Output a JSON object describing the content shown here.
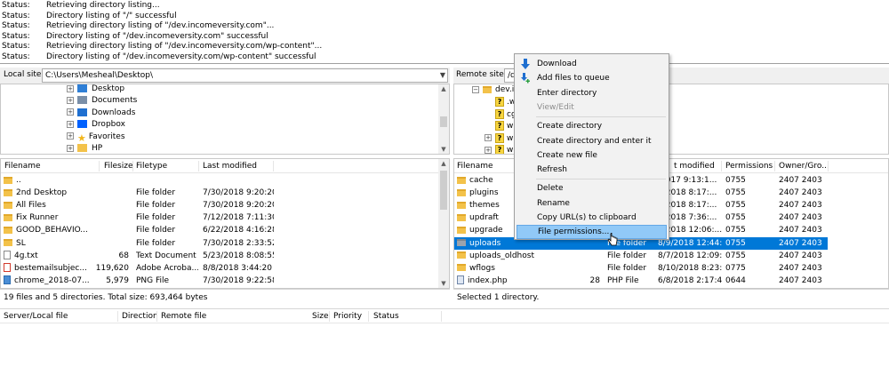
{
  "log": [
    {
      "label": "Status:",
      "text": "Retrieving directory listing..."
    },
    {
      "label": "Status:",
      "text": "Directory listing of \"/\" successful"
    },
    {
      "label": "Status:",
      "text": "Retrieving directory listing of \"/dev.incomeversity.com\"..."
    },
    {
      "label": "Status:",
      "text": "Directory listing of \"/dev.incomeversity.com\" successful"
    },
    {
      "label": "Status:",
      "text": "Retrieving directory listing of \"/dev.incomeversity.com/wp-content\"..."
    },
    {
      "label": "Status:",
      "text": "Directory listing of \"/dev.incomeversity.com/wp-content\" successful"
    }
  ],
  "local": {
    "label": "Local site:",
    "path": "C:\\Users\\Mesheal\\Desktop\\",
    "tree": [
      {
        "name": "Desktop",
        "icon": "desktop-icon"
      },
      {
        "name": "Documents",
        "icon": "documents-icon"
      },
      {
        "name": "Downloads",
        "icon": "downloads-icon"
      },
      {
        "name": "Dropbox",
        "icon": "dropbox-icon"
      },
      {
        "name": "Favorites",
        "icon": "favorites-icon"
      },
      {
        "name": "HP",
        "icon": "folder-icon"
      }
    ],
    "columns": {
      "filename": "Filename",
      "filesize": "Filesize",
      "filetype": "Filetype",
      "modified": "Last modified"
    },
    "files": [
      {
        "name": "..",
        "size": "",
        "type": "",
        "modified": "",
        "icon": "folder"
      },
      {
        "name": "2nd Desktop",
        "size": "",
        "type": "File folder",
        "modified": "7/30/2018 9:20:20 ...",
        "icon": "folder"
      },
      {
        "name": "All Files",
        "size": "",
        "type": "File folder",
        "modified": "7/30/2018 9:20:20 ...",
        "icon": "folder"
      },
      {
        "name": "Fix Runner",
        "size": "",
        "type": "File folder",
        "modified": "7/12/2018 7:11:30 ...",
        "icon": "folder"
      },
      {
        "name": "GOOD_BEHAVIO...",
        "size": "",
        "type": "File folder",
        "modified": "6/22/2018 4:16:28 ...",
        "icon": "folder"
      },
      {
        "name": "SL",
        "size": "",
        "type": "File folder",
        "modified": "7/30/2018 2:33:52 ...",
        "icon": "folder"
      },
      {
        "name": "4g.txt",
        "size": "68",
        "type": "Text Document",
        "modified": "5/23/2018 8:08:55 ...",
        "icon": "file"
      },
      {
        "name": "bestemailsubjec...",
        "size": "119,620",
        "type": "Adobe Acroba...",
        "modified": "8/8/2018 3:44:20 PM",
        "icon": "pdf"
      },
      {
        "name": "chrome_2018-07...",
        "size": "5,979",
        "type": "PNG File",
        "modified": "7/30/2018 9:22:58 ...",
        "icon": "png"
      }
    ],
    "status": "19 files and 5 directories. Total size: 693,464 bytes"
  },
  "remote": {
    "label": "Remote site:",
    "path": "/d",
    "tree_root": "dev.in",
    "tree": [
      ".w",
      "cg",
      "w",
      "w",
      "w"
    ],
    "columns": {
      "filename": "Filename",
      "modified": "t modified",
      "permissions": "Permissions",
      "owner": "Owner/Gro..."
    },
    "files": [
      {
        "name": "cache",
        "size": "",
        "type": "",
        "modified": "/2017 9:13:1...",
        "perms": "0755",
        "owner": "2407 2403",
        "icon": "folder"
      },
      {
        "name": "plugins",
        "size": "",
        "type": "",
        "modified": "0/2018 8:17:...",
        "perms": "0755",
        "owner": "2407 2403",
        "icon": "folder"
      },
      {
        "name": "themes",
        "size": "",
        "type": "",
        "modified": "0/2018 8:17:...",
        "perms": "0755",
        "owner": "2407 2403",
        "icon": "folder"
      },
      {
        "name": "updraft",
        "size": "",
        "type": "",
        "modified": "9/2018 7:36:...",
        "perms": "0755",
        "owner": "2407 2403",
        "icon": "folder"
      },
      {
        "name": "upgrade",
        "size": "",
        "type": "",
        "modified": "7/2018 12:06:...",
        "perms": "0755",
        "owner": "2407 2403",
        "icon": "folder"
      },
      {
        "name": "uploads",
        "size": "",
        "type": "File folder",
        "modified": "8/9/2018 12:44:...",
        "perms": "0755",
        "owner": "2407 2403",
        "icon": "folder-grey",
        "selected": true
      },
      {
        "name": "uploads_oldhost",
        "size": "",
        "type": "File folder",
        "modified": "8/7/2018 12:09:...",
        "perms": "0755",
        "owner": "2407 2403",
        "icon": "folder"
      },
      {
        "name": "wflogs",
        "size": "",
        "type": "File folder",
        "modified": "8/10/2018 8:23:...",
        "perms": "0775",
        "owner": "2407 2403",
        "icon": "folder"
      },
      {
        "name": "index.php",
        "size": "28",
        "type": "PHP File",
        "modified": "6/8/2018 2:17:4...",
        "perms": "0644",
        "owner": "2407 2403",
        "icon": "php"
      }
    ],
    "status": "Selected 1 directory."
  },
  "context_menu": [
    {
      "label": "Download",
      "icon": "download-icon",
      "disabled": false
    },
    {
      "label": "Add files to queue",
      "icon": "add-to-queue-icon",
      "disabled": false
    },
    {
      "label": "Enter directory",
      "icon": "",
      "disabled": false
    },
    {
      "label": "View/Edit",
      "icon": "",
      "disabled": true
    },
    {
      "separator": true
    },
    {
      "label": "Create directory",
      "icon": "",
      "disabled": false
    },
    {
      "label": "Create directory and enter it",
      "icon": "",
      "disabled": false
    },
    {
      "label": "Create new file",
      "icon": "",
      "disabled": false
    },
    {
      "label": "Refresh",
      "icon": "",
      "disabled": false
    },
    {
      "separator": true
    },
    {
      "label": "Delete",
      "icon": "",
      "disabled": false
    },
    {
      "label": "Rename",
      "icon": "",
      "disabled": false
    },
    {
      "label": "Copy URL(s) to clipboard",
      "icon": "",
      "disabled": false
    },
    {
      "label": "File permissions...",
      "icon": "",
      "disabled": false,
      "highlighted": true
    }
  ],
  "queue": {
    "columns": {
      "server": "Server/Local file",
      "direction": "Direction",
      "remote": "Remote file",
      "size": "Size",
      "priority": "Priority",
      "status": "Status"
    }
  },
  "colors": {
    "selection": "#0078d7",
    "menu_highlight": "#91c9f7",
    "folder": "#f3c24a"
  }
}
